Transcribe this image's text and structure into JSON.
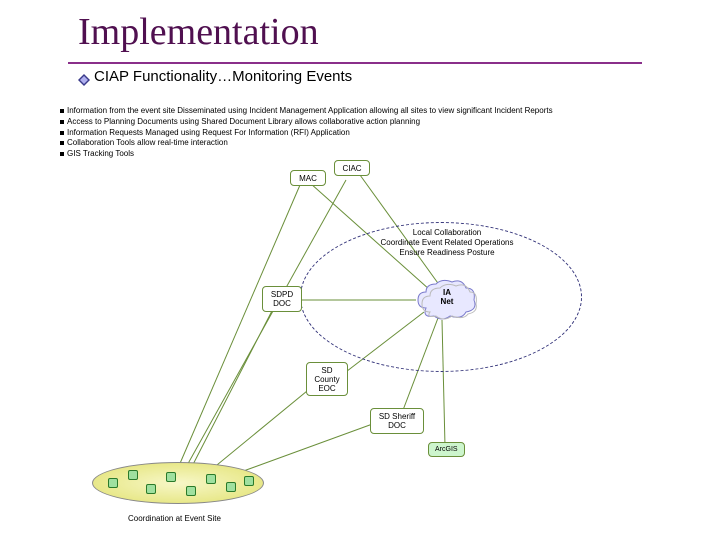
{
  "title": "Implementation",
  "subtitle": "CIAP Functionality…Monitoring Events",
  "bullets": [
    "Information from the event site Disseminated using Incident Management Application allowing all sites to view significant Incident Reports",
    "Access to Planning Documents using Shared Document Library allows collaborative action planning",
    "Information Requests Managed using Request For Information (RFI) Application",
    "Collaboration Tools allow real-time interaction",
    "GIS Tracking Tools"
  ],
  "nodes": {
    "mac": "MAC",
    "ciac": "CIAC",
    "sdpd_doc": "SDPD\nDOC",
    "sd_county_eoc": "SD\nCounty\nEOC",
    "sd_sheriff_doc": "SD Sheriff\nDOC",
    "ia_net": "IA\nNet",
    "arcgis": "ArcGIS"
  },
  "local_collab": [
    "Local Collaboration",
    "Coordinate Event Related Operations",
    "Ensure Readiness Posture"
  ],
  "caption_event": "Coordination at Event Site"
}
